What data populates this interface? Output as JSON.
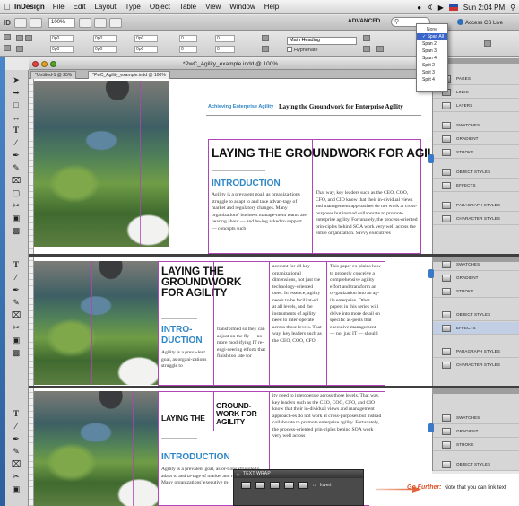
{
  "menubar": {
    "app_name": "InDesign",
    "items": [
      "File",
      "Edit",
      "Layout",
      "Type",
      "Object",
      "Table",
      "View",
      "Window",
      "Help"
    ],
    "clock": "Sun 2:04 PM"
  },
  "appbar": {
    "logo": "ID",
    "zoom": "100%",
    "workspace": "ADVANCED",
    "access_cs_live": "Access CS Live"
  },
  "control": {
    "fields": [
      "0p0",
      "0p0",
      "0p0",
      "0p0",
      "0p0",
      "0p0",
      "0",
      "0",
      "0",
      "0"
    ],
    "paragraph_style": "Main Heading",
    "hyphenate_label": "Hyphenate"
  },
  "span_menu": {
    "options": [
      "None",
      "Span All",
      "Span 2",
      "Span 3",
      "Span 4",
      "Split 2",
      "Split 3",
      "Split 4"
    ],
    "selected": "Span All"
  },
  "document": {
    "title": "*PwC_Agility_example.indd @ 100%",
    "tabs": [
      "*Untitled-1 @ 25%",
      "*PwC_Agility_example.indd @ 100%"
    ],
    "running_head_left": "Achieving Enterprise Agility",
    "running_head_right": "Laying the Groundwork for Enterprise Agility"
  },
  "page1": {
    "heading": "LAYING THE GROUNDWORK FOR AGILITY",
    "intro": "INTRODUCTION",
    "col1": "Agility is a prevalent goal, as organiza-tions struggle to adapt to and take advan-tage of market and regulatory changes. Many organizations' business manage-ment teams are hearing about — and be-ing asked to support — concepts such",
    "col2": "That way, key leaders such as the CEO, COO, CFO, and CIO know that their in-dividual views and management approaches do not work at cross-purposes but instead collaborate to promote enterprise agility. Fortunately, the process-oriented prin-ciples behind SOA work very well across the entire organization. Savvy executives"
  },
  "page2": {
    "heading": "LAYING THE GROUNDWORK FOR AGILITY",
    "intro": "INTRO-DUCTION",
    "col1": "Agility is a preva-lent goal, as organi-zations struggle to",
    "col2": "transformed so they can adjust on the fly — no more mod-ifying IT re-engi-neering efforts that finish too late for",
    "col3": "account for all key organizational dimensions, not just the technology-oriented ones. In essence, agility needs to be facilitat-ed at all levels, and the instruments of agility need to inter-operate across those levels. That way, key leaders such as the CEO, COO, CFO,",
    "col4": "This paper ex-plains how to properly conceive a comprehensive agility effort and transform an or-ganization into an ag-ile enterprise. Other papers in this series will delve into more detail on specific as-pects that executive management — not just IT — should"
  },
  "page3": {
    "heading_left": "LAYING THE",
    "heading_right": "GROUND-WORK FOR AGILITY",
    "intro": "INTRODUCTION",
    "col1": "Agility is a prevalent goal, as or-tions struggle to adapt to and ta-tage of market and regulatory ch-Many organizations' executive m-",
    "col2": "ity need to interoperate across those levels. That way, key leaders such as the CEO, COO, CFO, and CIO know that their in-dividual views and management approach-es do not work at cross-purposes but instead collaborate to promote enterprise agility. Fortunately, the process-oriented prin-ciples behind SOA work very well across"
  },
  "panels": {
    "group1": [
      "PAGES",
      "LINKS",
      "LAYERS",
      "SWATCHES",
      "GRADIENT",
      "STROKE",
      "OBJECT STYLES",
      "EFFECTS",
      "PARAGRAPH STYLES",
      "CHARACTER STYLES"
    ],
    "group2": [
      "SWATCHES",
      "GRADIENT",
      "STROKE",
      "OBJECT STYLES",
      "EFFECTS",
      "PARAGRAPH STYLES",
      "CHARACTER STYLES"
    ],
    "group3": [
      "SWATCHES",
      "GRADIENT",
      "STROKE",
      "OBJECT STYLES"
    ]
  },
  "text_wrap": {
    "title": "TEXT WRAP",
    "invert_label": "Invert"
  },
  "callout": {
    "lead": "Go Further:",
    "text": "Note that you can link text"
  },
  "colors": {
    "accent_blue": "#2f86c6",
    "frame_magenta": "#b044b8",
    "selection_blue": "#3a66c9",
    "callout_orange": "#e0532a"
  }
}
